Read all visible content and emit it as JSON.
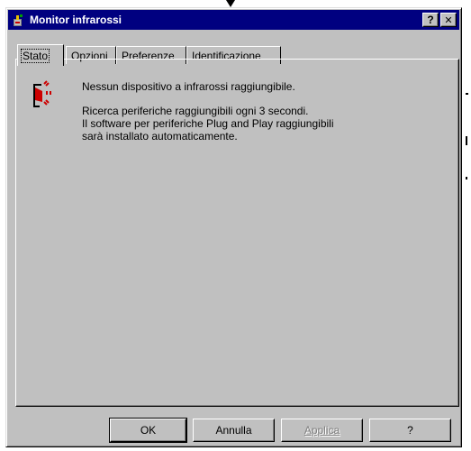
{
  "window": {
    "title": "Monitor infrarossi",
    "help_button": "?",
    "close_button": "✕"
  },
  "tabs": [
    {
      "label": "Stato",
      "active": true
    },
    {
      "label": "Opzioni",
      "active": false
    },
    {
      "label": "Preferenze",
      "active": false
    },
    {
      "label": "Identificazione",
      "active": false
    }
  ],
  "status": {
    "line1": "Nessun dispositivo a infrarossi raggiungibile.",
    "line2": "Ricerca periferiche raggiungibili ogni 3 secondi.",
    "line3": "Il software per periferiche Plug and Play raggiungibili",
    "line4": "sarà installato automaticamente."
  },
  "buttons": {
    "ok": "OK",
    "cancel": "Annulla",
    "apply": "Applica",
    "help": "?"
  },
  "icons": {
    "app": "infrared-monitor-icon",
    "status": "infrared-transmitter-icon"
  },
  "colors": {
    "title_bar": "#000080",
    "face": "#c0c0c0",
    "icon_red": "#cc0000"
  }
}
